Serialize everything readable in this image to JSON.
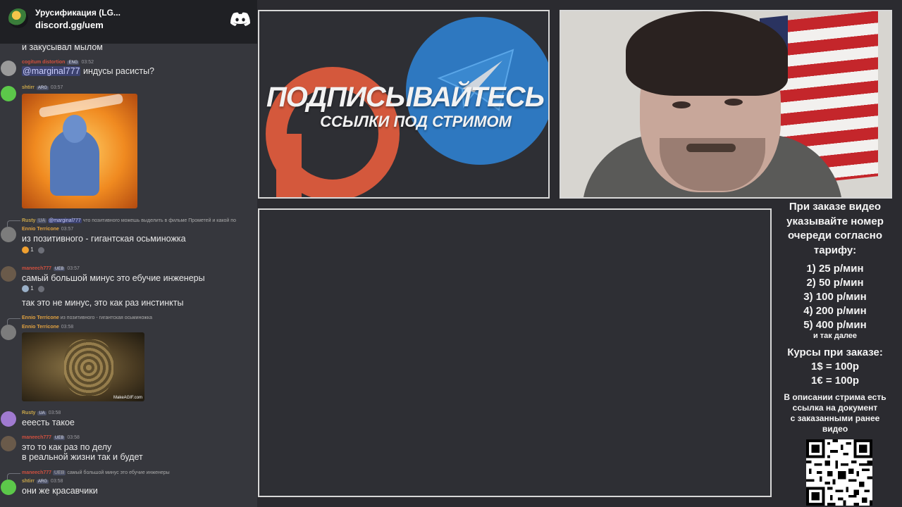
{
  "chat": {
    "server_name": "Урусификация (LG...",
    "server_link": "discord.gg/uem",
    "messages": [
      {
        "text": "и закусывал мылом"
      },
      {
        "user": "cogitum distortion",
        "badge": "ENG",
        "time": "03:52",
        "mention": "@marginal777",
        "text": "индусы расисты?"
      },
      {
        "user": "shtirr",
        "badge": "ARG",
        "time": "03:57",
        "image": "mmm, yummy gif"
      },
      {
        "reply_user": "Rusty",
        "reply_badge": "UA",
        "reply_mention": "@marginal777",
        "reply_text": "что позитивного можешь выделить в фильме Прометей и какой по"
      },
      {
        "user": "Ennio Terricone",
        "time": "03:57",
        "text": "из позитивного - гигантская осьминожка",
        "reaction_count": "1"
      },
      {
        "user": "maneech777",
        "badge": "UEB",
        "time": "03:57",
        "text": "самый большой минус это ебучие инженеры",
        "reaction_count": "1"
      },
      {
        "text": "так это не минус, это как раз инстинкты"
      },
      {
        "reply_user": "Ennio Terricone",
        "reply_text": "из позитивного - гигантская осьминожка"
      },
      {
        "user": "Ennio Terricone",
        "time": "03:58",
        "image": "MakeAGIF.com"
      },
      {
        "user": "Rusty",
        "badge": "UA",
        "time": "03:58",
        "text": "еeесть такое"
      },
      {
        "user": "maneech777",
        "badge": "UEB",
        "time": "03:58",
        "text": "это то как раз по делу",
        "text2": "в реальной жизни так и будет"
      },
      {
        "reply_user": "maneech777",
        "reply_badge": "UEB",
        "reply_text": "самый большой минус это ебучие инженеры"
      },
      {
        "user": "shtirr",
        "badge": "ARG",
        "time": "03:58",
        "text": "они же красавчики"
      }
    ]
  },
  "banner": {
    "title": "ПОДПИСЫВАЙТЕСЬ",
    "subtitle": "ССЫЛКИ ПОД СТРИМОМ"
  },
  "info": {
    "title": [
      "При заказе видео",
      "указывайте номер",
      "очереди согласно",
      "тарифу:"
    ],
    "tariffs": [
      "1) 25 р/мин",
      "2) 50 р/мин",
      "3) 100 р/мин",
      "4) 200 р/мин",
      "5) 400 р/мин"
    ],
    "etc": "и так далее",
    "rates_title": "Курсы при заказе:",
    "rates": [
      "1$ = 100р",
      "1€ = 100р"
    ],
    "note": [
      "В описании стрима есть",
      "ссылка на документ",
      "с заказанными ранее",
      "видео"
    ]
  }
}
